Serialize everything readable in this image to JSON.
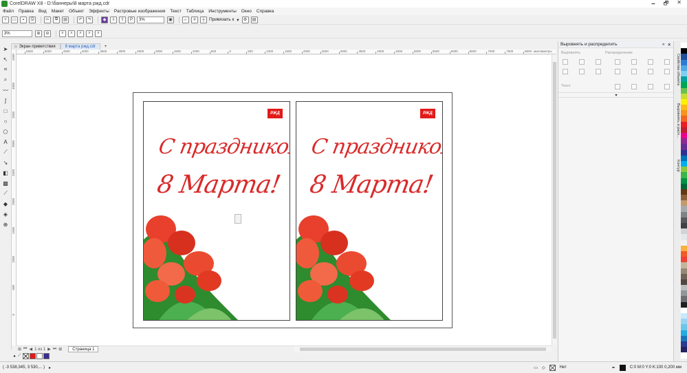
{
  "window": {
    "title": "CorelDRAW X8 - D:\\баннеры\\8 марта ржд.cdr",
    "controls": [
      "🗕",
      "🗗",
      "✕"
    ]
  },
  "menu": [
    "Файл",
    "Правка",
    "Вид",
    "Макет",
    "Объект",
    "Эффекты",
    "Растровые изображения",
    "Текст",
    "Таблица",
    "Инструменты",
    "Окно",
    "Справка"
  ],
  "standard_toolbar": {
    "zoom_value": "3%",
    "snap_label": "Привязать к"
  },
  "property_bar": {
    "zoom_value": "3%"
  },
  "doc_tabs": [
    {
      "label": "Экран приветствия",
      "active": false
    },
    {
      "label": "8 марта ржд.cdr",
      "active": true
    }
  ],
  "ruler": {
    "h_ticks": [
      "5500",
      "5000",
      "4500",
      "4000",
      "3500",
      "3000",
      "2500",
      "2000",
      "1500",
      "1000",
      "500",
      "0",
      "500",
      "1000",
      "1500",
      "2000",
      "2500",
      "3000",
      "3500",
      "4000",
      "4500",
      "5000",
      "5500",
      "6000",
      "6500",
      "7000",
      "7500",
      "8000"
    ],
    "h_unit": "миллиметры",
    "v_ticks": [
      "4500",
      "4000",
      "3500",
      "3000",
      "2500",
      "2000",
      "1500",
      "1000",
      "500",
      "0"
    ]
  },
  "banners": [
    {
      "logo": "РЖД",
      "line1": "С праздником",
      "line2": "8 Марта!"
    },
    {
      "logo": "РЖД",
      "line1": "С праздником",
      "line2": "8 Марта!"
    }
  ],
  "page_nav": {
    "counter": "1 из 1",
    "page_tab": "Страница 1"
  },
  "status": {
    "coords": "( -3 538,345; 3 530,... )",
    "fill_none": "Нет",
    "outline": "C:0 M:0 Y:0 K:100  0,200 мм"
  },
  "docker": {
    "title": "Выровнять и распределить",
    "align_label": "Выровнять",
    "distribute_label": "Распределение",
    "text_label": "Текст"
  },
  "docker_tabs": [
    "Свойства объекта",
    "Выровнять и расп...",
    "Контур"
  ],
  "colors": {
    "accent_red": "#d92b2b",
    "rzd_red": "#e21a1a",
    "active_tab": "#2a5db0"
  },
  "palette_colors": [
    "#ffffff",
    "#000000",
    "#1f4e9d",
    "#2a7bd6",
    "#4fa9e8",
    "#7ed0f0",
    "#00a39e",
    "#00a651",
    "#6cc04a",
    "#c8dc32",
    "#fff200",
    "#fdb913",
    "#f7941d",
    "#f26522",
    "#ed1c24",
    "#be1e2d",
    "#ec008c",
    "#92278f",
    "#662d91",
    "#2e3192",
    "#0072bc",
    "#00aeef",
    "#8dc63f",
    "#39b54a",
    "#009444",
    "#006838",
    "#603813",
    "#8b5e3c",
    "#c49a6c",
    "#a7a9ac",
    "#808285",
    "#58595b",
    "#414042",
    "#d1d3d4",
    "#e6e7e8",
    "#f1f2f2",
    "#fbb040",
    "#f15a29",
    "#ef4136",
    "#c2b59b",
    "#998675",
    "#736357",
    "#534741",
    "#bcbec0",
    "#939598",
    "#6d6e71",
    "#231f20",
    "#ffffff",
    "#c7eafb",
    "#9ad4f3",
    "#6cc6e8",
    "#27aae1",
    "#1c75bc",
    "#2b3990",
    "#262262",
    "#ffffff"
  ]
}
